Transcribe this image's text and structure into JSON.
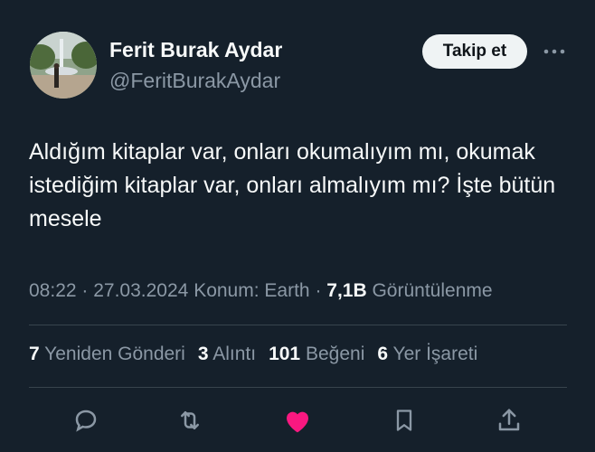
{
  "author": {
    "name": "Ferit Burak Aydar",
    "handle": "@FeritBurakAydar"
  },
  "follow_label": "Takip et",
  "tweet": {
    "text": "Aldığım kitaplar var, onları okumalıyım mı, okumak istediğim kitaplar var, onları almalıyım mı? İşte bütün mesele"
  },
  "meta": {
    "time": "08:22",
    "date": "27.03.2024",
    "location": "Konum: Earth",
    "views_count": "7,1B",
    "views_label": "Görüntülenme"
  },
  "stats": {
    "retweets": "7",
    "retweets_label": "Yeniden Gönderi",
    "quotes": "3",
    "quotes_label": "Alıntı",
    "likes": "101",
    "likes_label": "Beğeni",
    "bookmarks": "6",
    "bookmarks_label": "Yer İşareti"
  },
  "icons": {
    "reply": "reply-icon",
    "retweet": "retweet-icon",
    "like": "heart-icon",
    "bookmark": "bookmark-icon",
    "share": "share-icon",
    "more": "more-icon"
  },
  "colors": {
    "background": "#15202b",
    "like_active": "#f91880",
    "muted": "#8b98a5"
  }
}
